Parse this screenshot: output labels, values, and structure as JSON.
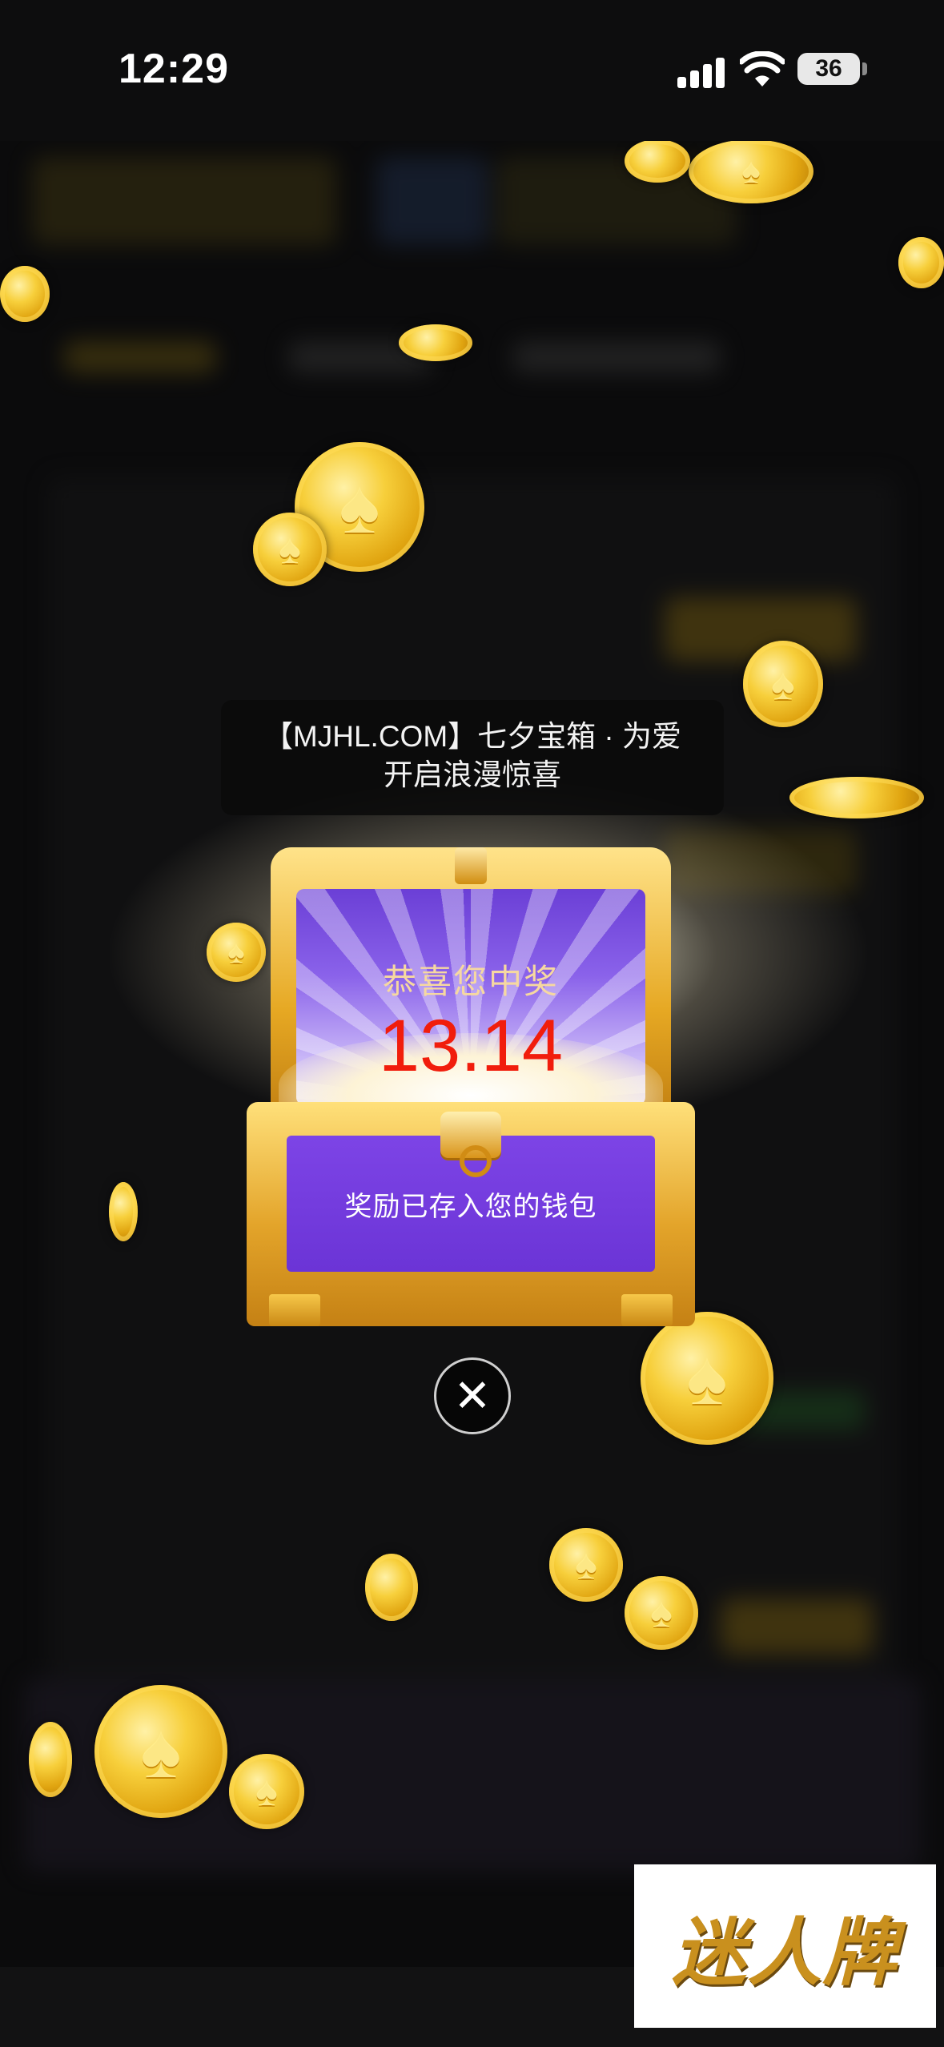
{
  "status_bar": {
    "time": "12:29",
    "battery": "36"
  },
  "banner": {
    "line1": "【MJHL.COM】七夕宝箱 · 为爱",
    "line2": "开启浪漫惊喜"
  },
  "chest": {
    "congrats": "恭喜您中奖",
    "amount": "13.14",
    "wallet_note": "奖励已存入您的钱包"
  },
  "close_button": {
    "icon": "close-icon"
  },
  "watermark": {
    "text": "迷人牌"
  },
  "colors": {
    "amount": "#f11d0c",
    "chest_purple": "#7d44e6",
    "gold": "#e6a823",
    "background": "#0b0b0c"
  }
}
